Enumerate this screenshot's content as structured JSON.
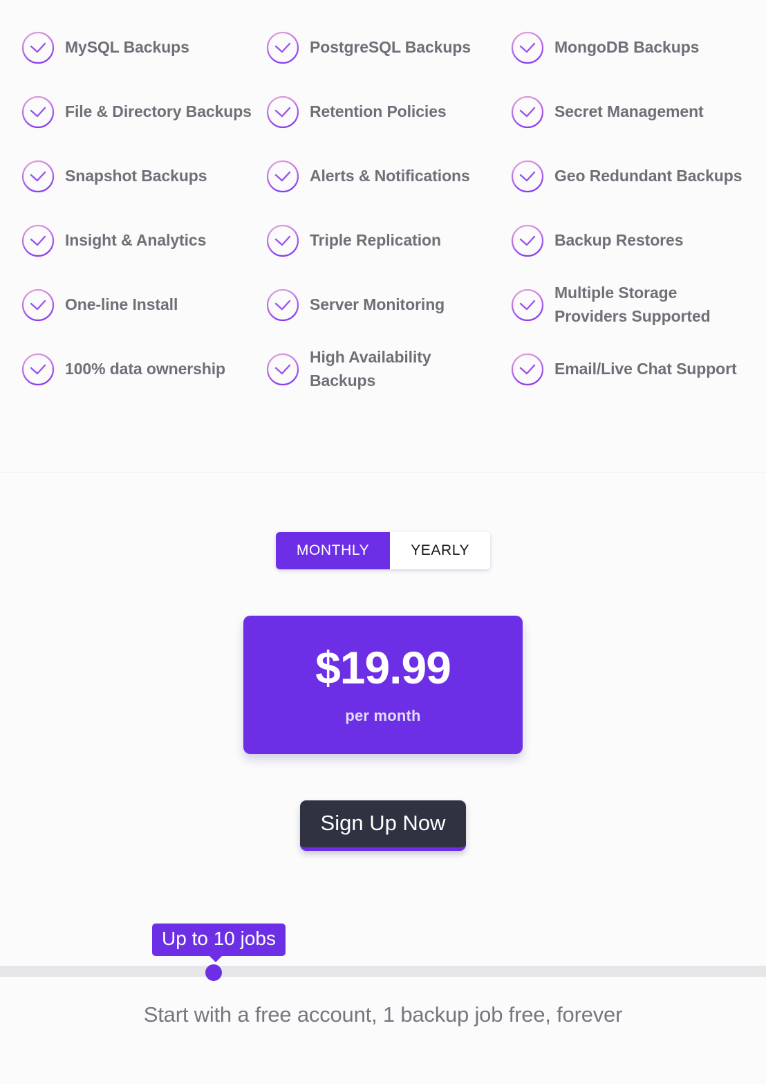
{
  "features": {
    "icon_name": "check-circle-icon",
    "items": [
      "MySQL Backups",
      "PostgreSQL Backups",
      "MongoDB Backups",
      "File & Directory Backups",
      "Retention Policies",
      "Secret Management",
      "Snapshot Backups",
      "Alerts & Notifications",
      "Geo Redundant Backups",
      "Insight & Analytics",
      "Triple Replication",
      "Backup Restores",
      "One-line Install",
      "Server Monitoring",
      "Multiple Storage Providers Supported",
      "100% data ownership",
      "High Availability Backups",
      "Email/Live Chat Support"
    ]
  },
  "pricing": {
    "billing_toggle": {
      "options": [
        "MONTHLY",
        "YEARLY"
      ],
      "selected": "MONTHLY"
    },
    "price": {
      "amount": "$19.99",
      "period": "per month"
    },
    "cta_label": "Sign Up Now",
    "slider": {
      "tooltip": "Up to 10 jobs",
      "value": 10,
      "min": 1,
      "max": 100,
      "thumb_position_pct": 28
    },
    "footnote": "Start with a free account, 1 backup job free, forever"
  },
  "colors": {
    "accent_purple": "#6d2fe6",
    "icon_purple": "#a05ae8",
    "text_gray": "#6f6f77",
    "dark_button": "#2f3341",
    "page_background": "#fbfbfc",
    "slider_track": "#e6e6e8"
  }
}
